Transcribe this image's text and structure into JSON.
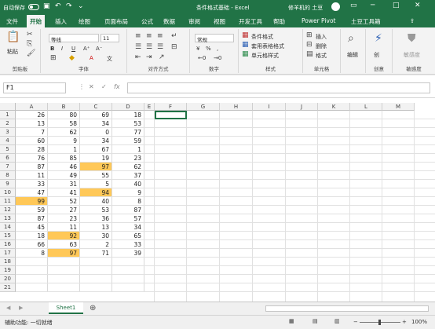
{
  "titlebar": {
    "autosave_label": "自动保存",
    "autosave_state": "关",
    "title": "条件格式基础 - Excel",
    "user": "修羊机的 土豆",
    "accent": "#217346"
  },
  "tabs": [
    {
      "label": "文件"
    },
    {
      "label": "开始"
    },
    {
      "label": "插入"
    },
    {
      "label": "绘图"
    },
    {
      "label": "页面布局"
    },
    {
      "label": "公式"
    },
    {
      "label": "数据"
    },
    {
      "label": "审阅"
    },
    {
      "label": "视图"
    },
    {
      "label": "开发工具"
    },
    {
      "label": "帮助"
    },
    {
      "label": "Power Pivot"
    },
    {
      "label": "土豆工具箱"
    }
  ],
  "ribbon": {
    "paste": "粘贴",
    "clipboard": "剪贴板",
    "font_name": "等线",
    "font_size": "11",
    "font": "字体",
    "alignment": "对齐方式",
    "number_format": "常规",
    "number": "数字",
    "cond_format": "条件格式",
    "table_format": "套用表格格式",
    "cell_style": "单元格样式",
    "styles": "样式",
    "insert": "插入",
    "delete": "删除",
    "format": "格式",
    "cells": "单元格",
    "editing": "编辑",
    "create": "创意",
    "sensitivity_btn": "敏感度",
    "sensitivity": "敏感度"
  },
  "formula_bar": {
    "namebox": "F1",
    "fx": "fx",
    "formula": ""
  },
  "columns": [
    "A",
    "B",
    "C",
    "D",
    "E",
    "F",
    "G",
    "H",
    "I",
    "J",
    "K",
    "L",
    "M"
  ],
  "rows": [
    {
      "n": "1",
      "v": [
        "26",
        "80",
        "69",
        "18"
      ]
    },
    {
      "n": "2",
      "v": [
        "13",
        "58",
        "34",
        "53"
      ]
    },
    {
      "n": "3",
      "v": [
        "7",
        "62",
        "0",
        "77"
      ]
    },
    {
      "n": "4",
      "v": [
        "60",
        "9",
        "34",
        "59"
      ]
    },
    {
      "n": "5",
      "v": [
        "28",
        "1",
        "67",
        "1"
      ]
    },
    {
      "n": "6",
      "v": [
        "76",
        "85",
        "19",
        "23"
      ]
    },
    {
      "n": "7",
      "v": [
        "87",
        "46",
        "97",
        "62"
      ]
    },
    {
      "n": "8",
      "v": [
        "11",
        "49",
        "55",
        "37"
      ]
    },
    {
      "n": "9",
      "v": [
        "33",
        "31",
        "5",
        "40"
      ]
    },
    {
      "n": "10",
      "v": [
        "47",
        "41",
        "94",
        "9"
      ]
    },
    {
      "n": "11",
      "v": [
        "99",
        "52",
        "40",
        "8"
      ]
    },
    {
      "n": "12",
      "v": [
        "59",
        "27",
        "53",
        "87"
      ]
    },
    {
      "n": "13",
      "v": [
        "87",
        "23",
        "36",
        "57"
      ]
    },
    {
      "n": "14",
      "v": [
        "45",
        "11",
        "13",
        "34"
      ]
    },
    {
      "n": "15",
      "v": [
        "18",
        "92",
        "30",
        "65"
      ]
    },
    {
      "n": "16",
      "v": [
        "66",
        "63",
        "2",
        "33"
      ]
    },
    {
      "n": "17",
      "v": [
        "8",
        "97",
        "71",
        "39"
      ]
    },
    {
      "n": "18",
      "v": [
        "",
        "",
        "",
        ""
      ]
    },
    {
      "n": "19",
      "v": [
        "",
        "",
        "",
        ""
      ]
    },
    {
      "n": "20",
      "v": [
        "",
        "",
        "",
        ""
      ]
    },
    {
      "n": "21",
      "v": [
        "",
        "",
        "",
        ""
      ]
    }
  ],
  "highlight_color": "#ffc858",
  "sheet_tab": "Sheet1",
  "status": {
    "text": "辅助功能: 一切就绪",
    "zoom": "100%"
  }
}
